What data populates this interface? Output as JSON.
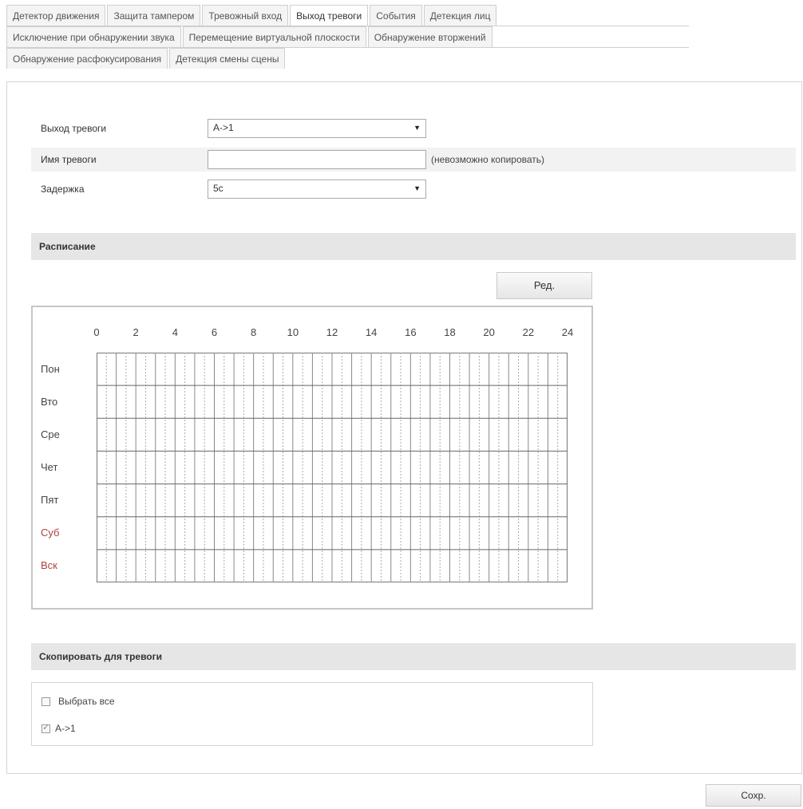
{
  "tabs": {
    "row1": [
      "Детектор движения",
      "Защита тампером",
      "Тревожный вход",
      "Выход тревоги",
      "События",
      "Детекция лиц"
    ],
    "row2": [
      "Исключение при обнаружении звука",
      "Перемещение виртуальной плоскости",
      "Обнаружение вторжений"
    ],
    "row3": [
      "Обнаружение расфокусирования",
      "Детекция смены сцены"
    ],
    "active": "Выход тревоги"
  },
  "form": {
    "alarm_output_label": "Выход тревоги",
    "alarm_output_value": "A->1",
    "alarm_name_label": "Имя тревоги",
    "alarm_name_value": "",
    "alarm_name_note": "(невозможно копировать)",
    "delay_label": "Задержка",
    "delay_value": "5с"
  },
  "schedule": {
    "title": "Расписание",
    "edit_button": "Ред.",
    "hours": [
      "0",
      "2",
      "4",
      "6",
      "8",
      "10",
      "12",
      "14",
      "16",
      "18",
      "20",
      "22",
      "24"
    ],
    "days": [
      {
        "label": "Пон",
        "weekend": false
      },
      {
        "label": "Вто",
        "weekend": false
      },
      {
        "label": "Сре",
        "weekend": false
      },
      {
        "label": "Чет",
        "weekend": false
      },
      {
        "label": "Пят",
        "weekend": false
      },
      {
        "label": "Суб",
        "weekend": true
      },
      {
        "label": "Вск",
        "weekend": true
      }
    ]
  },
  "copy": {
    "title": "Скопировать для тревоги",
    "select_all_label": "Выбрать все",
    "select_all_checked": false,
    "items": [
      {
        "label": "A->1",
        "checked": true
      }
    ]
  },
  "save_button": "Сохр.",
  "colors": {
    "weekend": "#b04040",
    "section_bar": "#e6e6e6"
  }
}
